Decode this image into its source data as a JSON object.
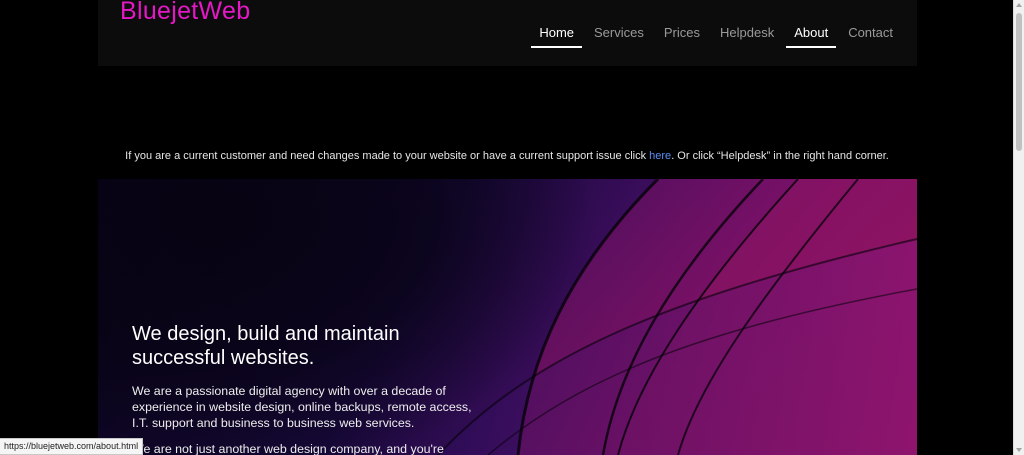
{
  "site": {
    "logo": "BluejetWeb",
    "brand_color": "#e418c4"
  },
  "nav": {
    "items": [
      {
        "label": "Home",
        "active": true
      },
      {
        "label": "Services",
        "active": false
      },
      {
        "label": "Prices",
        "active": false
      },
      {
        "label": "Helpdesk",
        "active": false
      },
      {
        "label": "About",
        "active": true
      },
      {
        "label": "Contact",
        "active": false
      }
    ]
  },
  "notice": {
    "text_before": "If you are a current customer and need changes made to your website or have a current support issue click ",
    "link_label": "here",
    "text_after": ". Or click “Helpdesk” in the right hand corner.",
    "link_color": "#5b8ef2"
  },
  "hero": {
    "title": "We design, build and maintain successful websites.",
    "paragraph1": "We are a passionate digital agency with over a decade of experience in website design, online backups, remote access, I.T. support and business to business web services.",
    "paragraph2": "We are not just another web design company, and you're"
  },
  "status_bar": {
    "url": "https://bluejetweb.com/about.html"
  }
}
